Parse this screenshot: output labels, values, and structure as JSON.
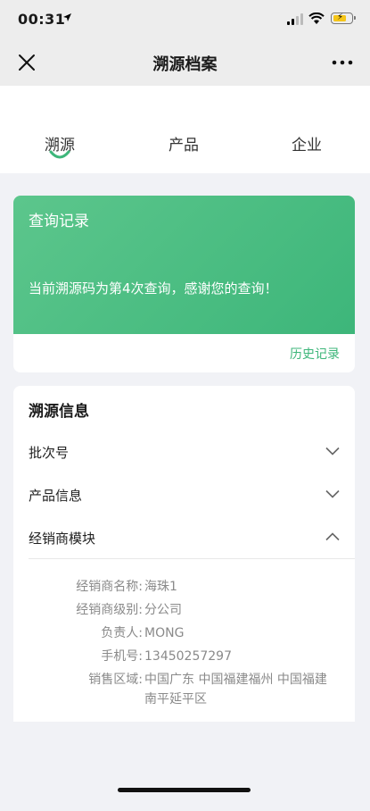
{
  "status_bar": {
    "time": "00:31"
  },
  "nav": {
    "title": "溯源档案"
  },
  "tabs": [
    {
      "label": "溯源",
      "active": true
    },
    {
      "label": "产品",
      "active": false
    },
    {
      "label": "企业",
      "active": false
    }
  ],
  "query": {
    "title": "查询记录",
    "message": "当前溯源码为第4次查询，感谢您的查询！",
    "history_link": "历史记录"
  },
  "trace_info": {
    "title": "溯源信息",
    "sections": [
      {
        "label": "批次号",
        "expanded": false
      },
      {
        "label": "产品信息",
        "expanded": false
      },
      {
        "label": "经销商模块",
        "expanded": true
      }
    ],
    "dealer": [
      {
        "key": "经销商名称:",
        "value": "海珠1"
      },
      {
        "key": "经销商级别:",
        "value": "分公司"
      },
      {
        "key": "负责人:",
        "value": "MONG"
      },
      {
        "key": "手机号:",
        "value": "13450257297"
      },
      {
        "key": "销售区域:",
        "value": "中国广东 中国福建福州 中国福建南平延平区"
      }
    ]
  },
  "colors": {
    "accent": "#3db67a",
    "status_bar": "#ededed",
    "page_bg": "#f1f2f6"
  }
}
